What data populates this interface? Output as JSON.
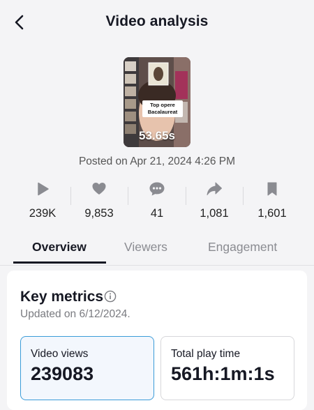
{
  "header": {
    "title": "Video analysis"
  },
  "video": {
    "duration": "53.65s",
    "caption_line1": "Top opere",
    "caption_line2": "Bacalaureat",
    "posted": "Posted on Apr 21, 2024 4:26 PM"
  },
  "stats": [
    {
      "icon": "play-icon",
      "value": "239K"
    },
    {
      "icon": "heart-icon",
      "value": "9,853"
    },
    {
      "icon": "comment-icon",
      "value": "41"
    },
    {
      "icon": "share-icon",
      "value": "1,081"
    },
    {
      "icon": "bookmark-icon",
      "value": "1,601"
    }
  ],
  "tabs": [
    {
      "label": "Overview",
      "active": true
    },
    {
      "label": "Viewers",
      "active": false
    },
    {
      "label": "Engagement",
      "active": false
    }
  ],
  "key_metrics": {
    "title": "Key metrics",
    "updated": "Updated on 6/12/2024.",
    "cards": [
      {
        "label": "Video views",
        "value": "239083",
        "selected": true
      },
      {
        "label": "Total play time",
        "value": "561h:1m:1s",
        "selected": false
      }
    ]
  },
  "colors": {
    "accent": "#3a9bd8",
    "text": "#161823",
    "muted": "#8a8b91",
    "background": "#f4f4f6"
  }
}
